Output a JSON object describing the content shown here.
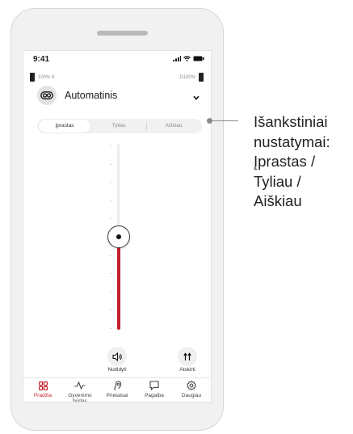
{
  "status_bar": {
    "time": "9:41"
  },
  "battery": {
    "left": "100% K",
    "right": "D100%"
  },
  "program": {
    "name": "Automatinis",
    "icon": "program-icon"
  },
  "presets": {
    "items": [
      "Įprastas",
      "Tyliau",
      "Aiškiau"
    ],
    "selected": "Įprastas"
  },
  "volume": {
    "level": 0.5
  },
  "controls": {
    "mute_label": "Nutildyti",
    "split_label": "Atskirti"
  },
  "nav": {
    "items": [
      {
        "label": "Pradžia",
        "icon": "home-grid-icon",
        "active": true
      },
      {
        "label": "Gyvenimo būdas",
        "icon": "activity-icon",
        "active": false
      },
      {
        "label": "Prietaisai",
        "icon": "hearing-aid-icon",
        "active": false
      },
      {
        "label": "Pagalba",
        "icon": "chat-icon",
        "active": false
      },
      {
        "label": "Daugiau",
        "icon": "settings-icon",
        "active": false
      }
    ]
  },
  "annotation": {
    "lines": [
      "Išankstiniai",
      "nustatymai:",
      "Įprastas /",
      "Tyliau /",
      "Aiškiau"
    ]
  },
  "colors": {
    "accent": "#c4202b",
    "slider_track": "#ececec"
  }
}
